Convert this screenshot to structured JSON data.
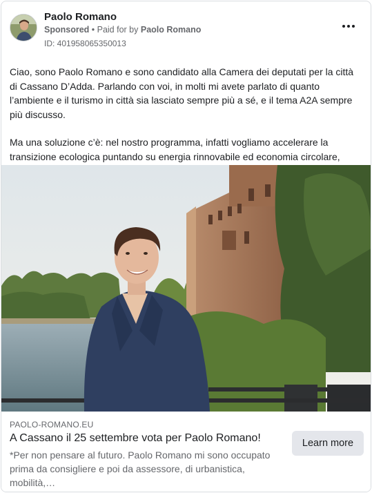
{
  "post": {
    "author": "Paolo Romano",
    "sponsored_label": "Sponsored",
    "paid_prefix": " • Paid for by ",
    "payer": "Paolo Romano",
    "ad_id": "ID: 401958065350013",
    "paragraphs": [
      "Ciao, sono Paolo Romano e sono candidato alla Camera dei deputati per la città di Cassano D’Adda. Parlando con voi, in molti mi avete parlato di quanto l’ambiente e il turismo in città sia lasciato sempre più a sé, e il tema A2A sempre più discusso.",
      "Ma una soluzione c’è: nel nostro programma, infatti vogliamo accelerare la transizione ecologica puntando su energia rinnovabile ed economia circolare, vogliamo dire stop al consumo di suolo, e dare vita ad un piano straordinario per…"
    ]
  },
  "link": {
    "domain": "PAOLO-ROMANO.EU",
    "headline": "A Cassano il 25 settembre vota per Paolo Romano!",
    "description": "*Per non pensare al futuro. Paolo Romano mi sono occupato prima da consigliere e poi da assessore, di urbanistica, mobilità,…",
    "cta_label": "Learn more"
  },
  "icons": {
    "more": "more-options-icon"
  }
}
